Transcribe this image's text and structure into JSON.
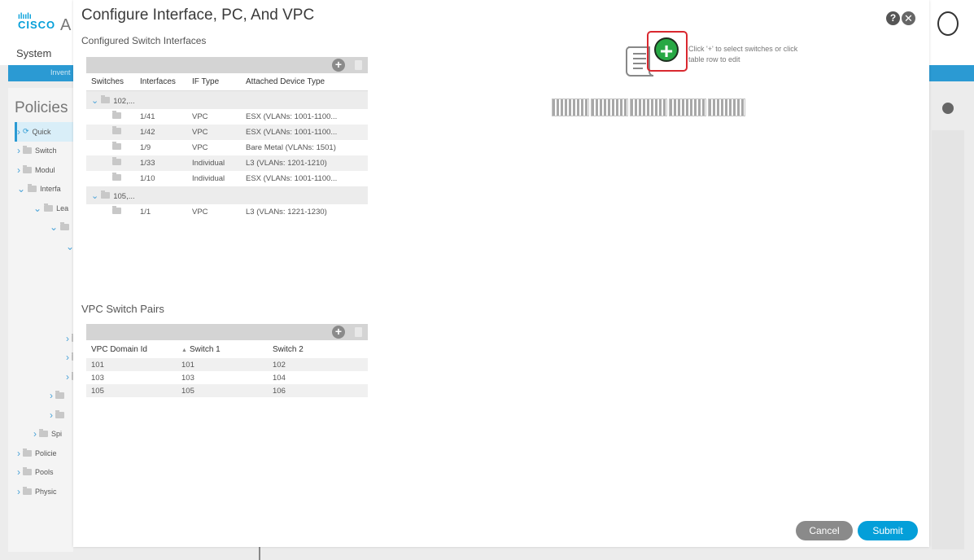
{
  "background": {
    "logo_bars": "ılıılı",
    "logo_word": "CISCO",
    "app_initial": "A",
    "system_label": "System",
    "inventory_tab": "Invent",
    "policies_heading": "Policies",
    "tree": [
      {
        "label": "Quick",
        "indent": 0,
        "selected": true,
        "chev": ">"
      },
      {
        "label": "Switch",
        "indent": 0,
        "chev": ">"
      },
      {
        "label": "Modul",
        "indent": 0,
        "chev": ">"
      },
      {
        "label": "Interfa",
        "indent": 0,
        "chev": "v"
      },
      {
        "label": "Lea",
        "indent": 1,
        "chev": "v"
      },
      {
        "label": "",
        "indent": 2,
        "chev": "v"
      },
      {
        "label": "",
        "indent": 3,
        "chev": "v"
      }
    ],
    "tree_bottom": [
      {
        "label": "",
        "indent": 3,
        "chev": ">"
      },
      {
        "label": "",
        "indent": 3,
        "chev": ">"
      },
      {
        "label": "",
        "indent": 3,
        "chev": ">"
      },
      {
        "label": "",
        "indent": 2,
        "chev": ">"
      },
      {
        "label": "",
        "indent": 2,
        "chev": ">"
      },
      {
        "label": "Spi",
        "indent": 1,
        "chev": ">"
      },
      {
        "label": "Policie",
        "indent": 0,
        "chev": ">"
      },
      {
        "label": "Pools",
        "indent": 0,
        "chev": ">"
      },
      {
        "label": "Physic",
        "indent": 0,
        "chev": ">"
      }
    ]
  },
  "dialog": {
    "title": "Configure Interface, PC, And VPC",
    "help": "?",
    "close": "✕",
    "interfaces_section": "Configured Switch Interfaces",
    "interfaces_headers": [
      "Switches",
      "Interfaces",
      "IF Type",
      "Attached Device Type"
    ],
    "groups": [
      {
        "label": "102,...",
        "rows": [
          {
            "interface": "1/41",
            "type": "VPC",
            "device": "ESX (VLANs: 1001-1100..."
          },
          {
            "interface": "1/42",
            "type": "VPC",
            "device": "ESX (VLANs: 1001-1100..."
          },
          {
            "interface": "1/9",
            "type": "VPC",
            "device": "Bare Metal (VLANs: 1501)"
          },
          {
            "interface": "1/33",
            "type": "Individual",
            "device": "L3 (VLANs: 1201-1210)"
          },
          {
            "interface": "1/10",
            "type": "Individual",
            "device": "ESX (VLANs: 1001-1100..."
          }
        ]
      },
      {
        "label": "105,...",
        "rows": [
          {
            "interface": "1/1",
            "type": "VPC",
            "device": "L3 (VLANs: 1221-1230)"
          }
        ]
      }
    ],
    "vpc_section": "VPC Switch Pairs",
    "vpc_headers": [
      "VPC Domain Id",
      "Switch 1",
      "Switch 2"
    ],
    "vpc_sort_glyph": "▲",
    "vpc_rows": [
      {
        "domain": "101",
        "s1": "101",
        "s2": "102"
      },
      {
        "domain": "103",
        "s1": "103",
        "s2": "104"
      },
      {
        "domain": "105",
        "s1": "105",
        "s2": "106"
      }
    ],
    "add_glyph": "+",
    "hint_line1": "Click '+' to select switches or click",
    "hint_line2": "table row to edit",
    "cancel": "Cancel",
    "submit": "Submit",
    "colors": {
      "accent": "#049fd9",
      "add_green": "#27a844",
      "highlight_red": "#d9282f"
    }
  }
}
